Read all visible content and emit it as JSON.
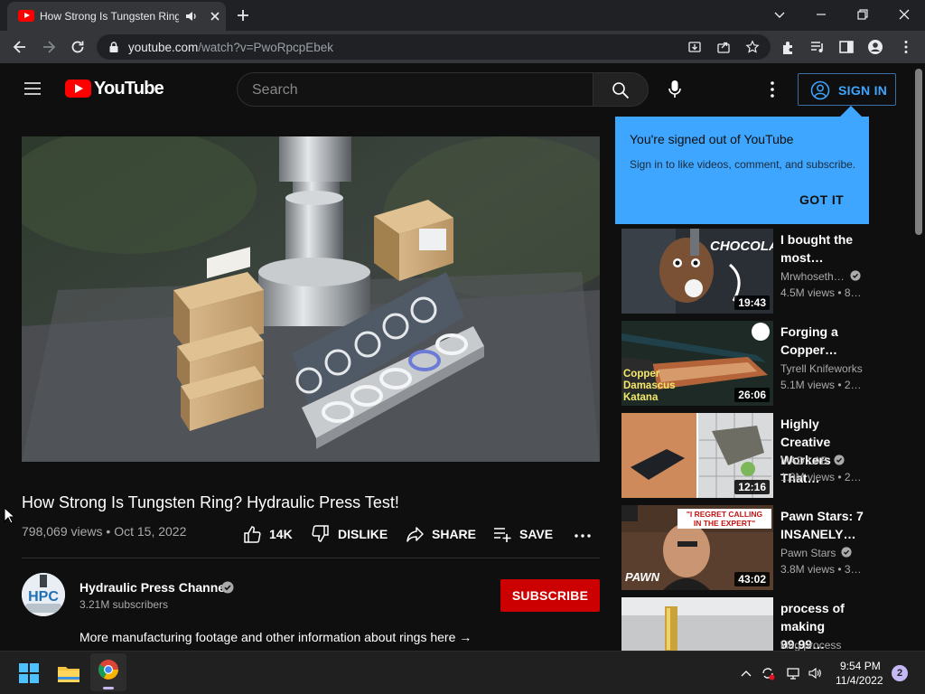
{
  "browser": {
    "tab_title": "How Strong Is Tungsten Ring? Hydraulic Press Test! - YouTube",
    "url_host": "youtube.com",
    "url_path": "/watch?v=PwoRpcpEbek"
  },
  "header": {
    "logo_text": "YouTube",
    "search_placeholder": "Search",
    "sign_in_label": "SIGN IN"
  },
  "video": {
    "title": "How Strong Is Tungsten Ring? Hydraulic Press Test!",
    "views": "798,069 views",
    "date": "Oct 15, 2022",
    "meta_separator": "•",
    "likes": "14K",
    "dislike_label": "DISLIKE",
    "share_label": "SHARE",
    "save_label": "SAVE"
  },
  "channel": {
    "name": "Hydraulic Press Channel",
    "avatar_text": "HPC",
    "subscribers": "3.21M subscribers",
    "subscribe_label": "SUBSCRIBE",
    "description": "More manufacturing footage and other information about rings here →"
  },
  "popup": {
    "title": "You're signed out of YouTube",
    "body": "Sign in to like videos, comment, and subscribe.",
    "button": "GOT IT"
  },
  "related": [
    {
      "title": "I bought the most…",
      "channel": "Mrwhoseth…",
      "verified": true,
      "views": "4.5M views • 8…",
      "duration": "19:43",
      "thumb_text": "CHOCOLATE"
    },
    {
      "title": "Forging a Copper…",
      "channel": "Tyrell Knifeworks",
      "verified": false,
      "views": "5.1M views • 2…",
      "duration": "26:06",
      "thumb_text": "Copper Damascus Katana"
    },
    {
      "title": "Highly Creative Workers That…",
      "channel": "MAD LAB",
      "verified": true,
      "views": "1.9M views • 2…",
      "duration": "12:16",
      "thumb_text": ""
    },
    {
      "title": "Pawn Stars: 7 INSANELY…",
      "channel": "Pawn Stars",
      "verified": true,
      "views": "3.8M views • 3…",
      "duration": "43:02",
      "thumb_text": "\"I REGRET CALLING IN THE EXPERT\""
    },
    {
      "title": "process of making 99.99…",
      "channel": "king process",
      "verified": false,
      "views": "",
      "duration": "",
      "thumb_text": ""
    }
  ],
  "taskbar": {
    "time": "9:54 PM",
    "date": "11/4/2022",
    "notification_count": "2"
  },
  "colors": {
    "background": "#0f0f0f",
    "accent_blue": "#3ea6ff",
    "subscribe_red": "#cc0000",
    "youtube_red": "#ff0000"
  }
}
